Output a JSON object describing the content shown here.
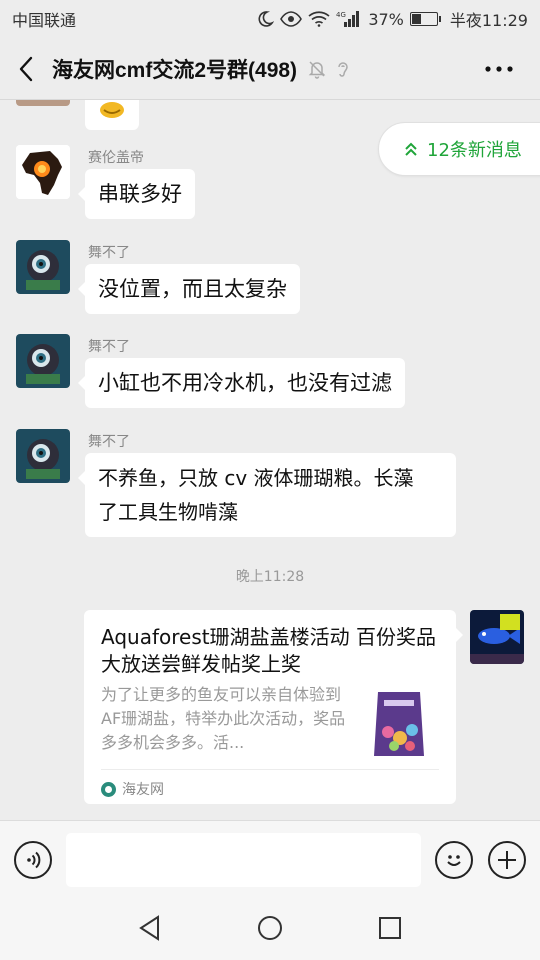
{
  "status_bar": {
    "carrier": "中国联通",
    "network": "4G",
    "battery_percent": "37%",
    "battery_level": 0.37,
    "time": "半夜11:29"
  },
  "header": {
    "title": "海友网cmf交流2号群(498)",
    "icons": [
      "back-arrow-icon",
      "mute-bell-icon",
      "earphone-icon",
      "more-icon"
    ]
  },
  "new_messages_pill": "12条新消息",
  "messages": [
    {
      "sender": "赛伦盖帝",
      "text": "串联多好"
    },
    {
      "sender": "舞不了",
      "text": "没位置，而且太复杂"
    },
    {
      "sender": "舞不了",
      "text": "小缸也不用冷水机，也没有过滤"
    },
    {
      "sender": "舞不了",
      "text_line1": "不养鱼，只放 cv 液体珊瑚粮。长藻",
      "text_line2": "了工具生物啃藻"
    }
  ],
  "time_divider": "晚上11:28",
  "link_card": {
    "title": "Aquaforest珊湖盐盖楼活动 百份奖品大放送尝鲜发帖奖上奖",
    "description": "为了让更多的鱼友可以亲自体验到AF珊湖盐，特举办此次活动，奖品多多机会多多。活...",
    "source": "海友网"
  },
  "input_bar": {
    "placeholder": "",
    "icons": [
      "voice-icon",
      "emoji-icon",
      "plus-icon"
    ]
  },
  "nav_bar": {
    "icons": [
      "nav-back-icon",
      "nav-home-icon",
      "nav-recents-icon"
    ]
  },
  "colors": {
    "background": "#ededed",
    "accent_green": "#20a53a",
    "bubble": "#ffffff"
  }
}
